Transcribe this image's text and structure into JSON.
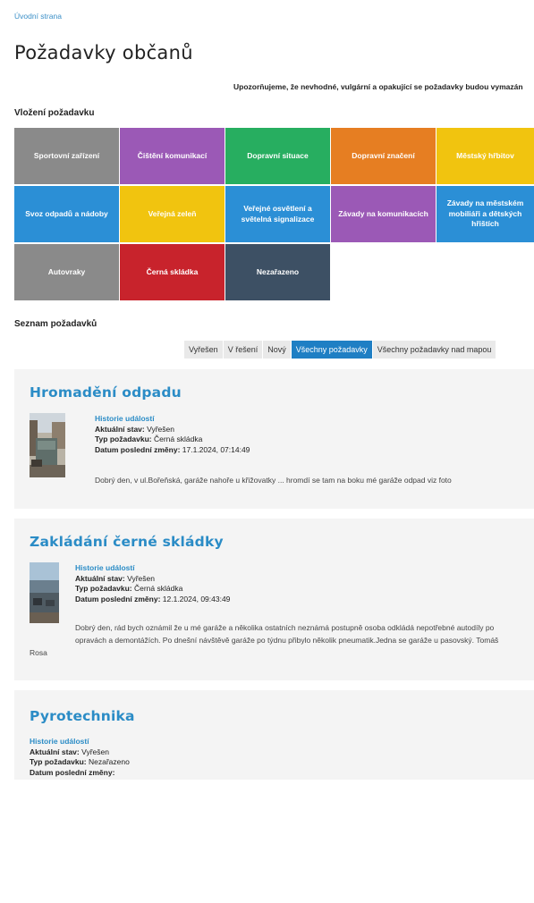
{
  "breadcrumb": "Úvodní strana",
  "page_title": "Požadavky občanů",
  "notice": "Upozorňujeme, že nevhodné, vulgární a opakující se požadavky budou vymazán",
  "insert_section": {
    "heading": "Vložení požadavku",
    "categories": [
      {
        "label": "Sportovní zařízení",
        "color": "#8a8a8a"
      },
      {
        "label": "Čištění komunikací",
        "color": "#9b59b6"
      },
      {
        "label": "Dopravní situace",
        "color": "#27ae60"
      },
      {
        "label": "Dopravní značení",
        "color": "#e67e22"
      },
      {
        "label": "Městský hřbitov",
        "color": "#f1c40f"
      },
      {
        "label": "Svoz odpadů a nádoby",
        "color": "#2b8fd6"
      },
      {
        "label": "Veřejná zeleň",
        "color": "#f1c40f"
      },
      {
        "label": "Veřejné osvětlení a světelná signalizace",
        "color": "#2b8fd6"
      },
      {
        "label": "Závady na komunikacích",
        "color": "#9b59b6"
      },
      {
        "label": "Závady na městském mobiliáři a dětských hřištích",
        "color": "#2b8fd6"
      },
      {
        "label": "Autovraky",
        "color": "#8a8a8a"
      },
      {
        "label": "Černá skládka",
        "color": "#c8232c"
      },
      {
        "label": "Nezařazeno",
        "color": "#3d5064"
      }
    ]
  },
  "list_section": {
    "heading": "Seznam požadavků",
    "tabs": [
      {
        "label": "Vyřešen",
        "active": false
      },
      {
        "label": "V řešení",
        "active": false
      },
      {
        "label": "Nový",
        "active": false
      },
      {
        "label": "Všechny požadavky",
        "active": true
      },
      {
        "label": "Všechny požadavky nad mapou",
        "active": false
      }
    ]
  },
  "labels": {
    "history": "Historie událostí",
    "state": "Aktuální stav:",
    "type": "Typ požadavku:",
    "changed": "Datum poslední změny:"
  },
  "requests": [
    {
      "title": "Hromadění odpadu",
      "state": "Vyřešen",
      "type": "Černá skládka",
      "changed": "17.1.2024, 07:14:49",
      "description": "Dobrý den, v ul.Bořeňská, garáže nahoře u křižovatky ... hromdí se tam na boku mé garáže odpad viz foto"
    },
    {
      "title": "Zakládání černé skládky",
      "state": "Vyřešen",
      "type": "Černá skládka",
      "changed": "12.1.2024, 09:43:49",
      "description_line1": "Dobrý den, rád bych oznámil že u mé garáže a několika ostatních neznámá postupně osoba odkládá nepotřebné autodíly po",
      "description_line2": "opravách a demontážích. Po dnešní návštěvě garáže po týdnu přibylo několik pneumatik.Jedna se garáže u pasovský. Tomáš",
      "description_line3": "Rosa"
    },
    {
      "title": "Pyrotechnika",
      "state": "Vyřešen",
      "type": "Nezařazeno"
    }
  ]
}
